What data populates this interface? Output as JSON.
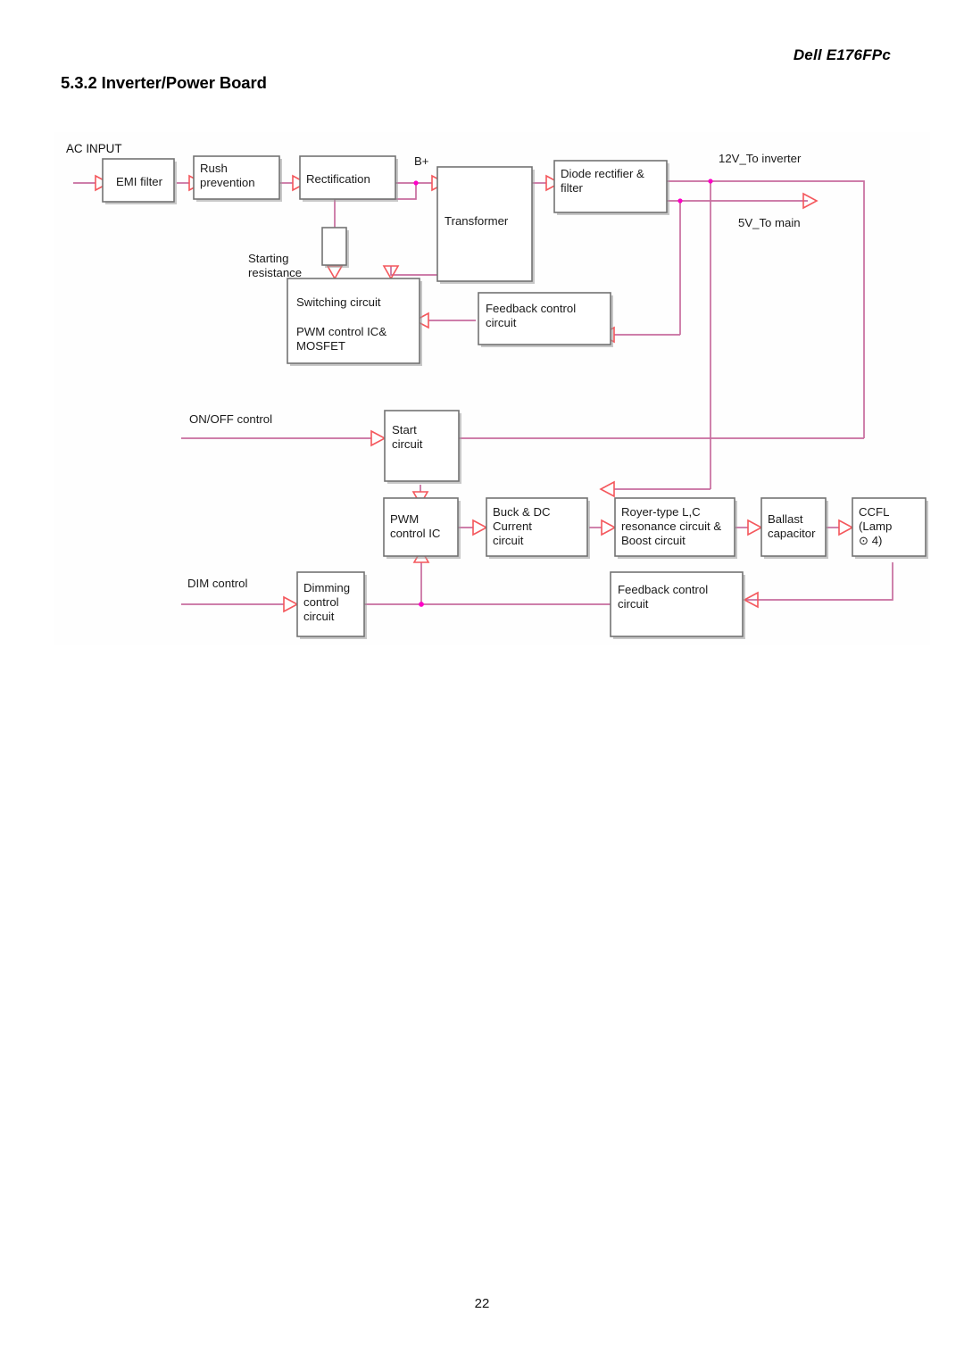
{
  "header": {
    "model": "Dell E176FPc"
  },
  "section": {
    "title": "5.3.2 Inverter/Power Board"
  },
  "footer": {
    "page_number": "22"
  },
  "colors": {
    "wire": "#c76c9e",
    "arrow": "#f4575c",
    "junction_dot": "#ff00c8",
    "block_border": "#737373",
    "text": "#1a1a1a"
  },
  "diagram": {
    "type": "block-diagram",
    "name": "inverter-power-board-block-diagram",
    "blocks": [
      {
        "id": "emi-filter",
        "label": "EMI filter",
        "align": "center"
      },
      {
        "id": "rush-prevention",
        "label_lines": [
          "Rush",
          "prevention"
        ],
        "align": "left"
      },
      {
        "id": "rectification",
        "label": "Rectification",
        "align": "left"
      },
      {
        "id": "starting-resistor",
        "label": "",
        "align": "center"
      },
      {
        "id": "transformer",
        "label": "Transformer",
        "align": "left"
      },
      {
        "id": "diode-rectifier",
        "label_lines": [
          "Diode rectifier &",
          "filter"
        ],
        "align": "left"
      },
      {
        "id": "switching-circuit",
        "label_lines": [
          "Switching circuit",
          "",
          "PWM control IC&",
          "MOSFET"
        ],
        "align": "left"
      },
      {
        "id": "feedback-top",
        "label_lines": [
          "Feedback control",
          "circuit"
        ],
        "align": "left"
      },
      {
        "id": "start-circuit",
        "label_lines": [
          "Start",
          "circuit"
        ],
        "align": "left"
      },
      {
        "id": "pwm-control-ic",
        "label_lines": [
          "PWM",
          "control IC"
        ],
        "align": "left"
      },
      {
        "id": "buck-dc-current",
        "label_lines": [
          "Buck & DC",
          "Current",
          "circuit"
        ],
        "align": "left"
      },
      {
        "id": "royer-resonance",
        "label_lines": [
          "Royer-type L,C",
          "resonance circuit &",
          "Boost circuit"
        ],
        "align": "left"
      },
      {
        "id": "ballast-capacitor",
        "label_lines": [
          "Ballast",
          "capacitor"
        ],
        "align": "left"
      },
      {
        "id": "ccfl-lamp",
        "label_lines": [
          "CCFL",
          "(Lamp",
          "⊙ 4)"
        ],
        "align": "left"
      },
      {
        "id": "dimming-control",
        "label_lines": [
          "Dimming",
          "control",
          "circuit"
        ],
        "align": "left"
      },
      {
        "id": "feedback-bottom",
        "label_lines": [
          "Feedback control",
          "circuit"
        ],
        "align": "left"
      }
    ],
    "annotations": {
      "ac_input": "AC INPUT",
      "b_plus": "B+",
      "starting_resistance": [
        "Starting",
        "resistance"
      ],
      "out_12v": "12V_To inverter",
      "out_5v": "5V_To main",
      "onoff_control": "ON/OFF control",
      "dim_control": "DIM control"
    },
    "signal_flow": [
      "AC INPUT → EMI filter → Rush prevention → Rectification → B+ → Transformer → Diode rectifier & filter",
      "Diode rectifier & filter → 12V_To inverter",
      "Diode rectifier & filter → 5V_To main",
      "B+ → Starting resistance → Switching circuit / PWM control IC& MOSFET",
      "Transformer → Switching circuit / PWM control IC& MOSFET",
      "Feedback control circuit → Switching circuit / PWM control IC& MOSFET",
      "12V and 5V rails → Feedback control circuit",
      "ON/OFF control → Start circuit",
      "12V rail → Start circuit",
      "Start circuit → PWM control IC",
      "PWM control IC → Buck & DC Current circuit → Royer-type L,C resonance circuit & Boost circuit → Ballast capacitor → CCFL (Lamp ⊙ 4)",
      "DIM control → Dimming control circuit → PWM control IC",
      "CCFL → Feedback control circuit → Dimming control node"
    ]
  }
}
